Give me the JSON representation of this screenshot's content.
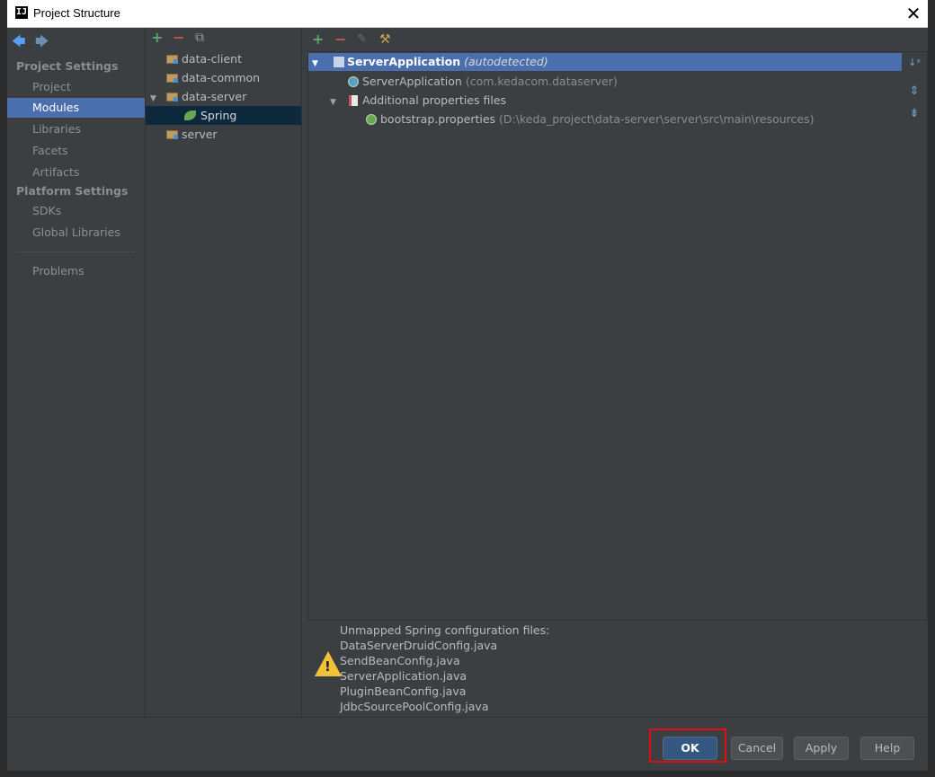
{
  "window": {
    "title": "Project Structure",
    "logo": "IJ"
  },
  "nav": {
    "project_settings_header": "Project Settings",
    "project_items": [
      "Project",
      "Modules",
      "Libraries",
      "Facets",
      "Artifacts"
    ],
    "platform_settings_header": "Platform Settings",
    "platform_items": [
      "SDKs",
      "Global Libraries"
    ],
    "problems": "Problems",
    "selected": "Modules"
  },
  "modules": {
    "items": [
      "data-client",
      "data-common",
      "data-server",
      "Spring",
      "server"
    ]
  },
  "spring_tree": {
    "root_label": "ServerApplication",
    "root_note": "(autodetected)",
    "app_label": "ServerApplication",
    "app_note": "(com.kedacom.dataserver)",
    "props_group": "Additional properties files",
    "props_file": "bootstrap.properties",
    "props_path": "(D:\\keda_project\\data-server\\server\\src\\main\\resources)"
  },
  "warning": {
    "title": "Unmapped Spring configuration files:",
    "files": [
      "DataServerDruidConfig.java",
      "SendBeanConfig.java",
      "ServerApplication.java",
      "PluginBeanConfig.java",
      "JdbcSourcePoolConfig.java"
    ]
  },
  "buttons": {
    "ok": "OK",
    "cancel": "Cancel",
    "apply": "Apply",
    "help": "Help"
  },
  "colors": {
    "selection": "#4b6eaf",
    "ok_button": "#365880",
    "highlight": "#e01010",
    "spring": "#6aa84f"
  }
}
